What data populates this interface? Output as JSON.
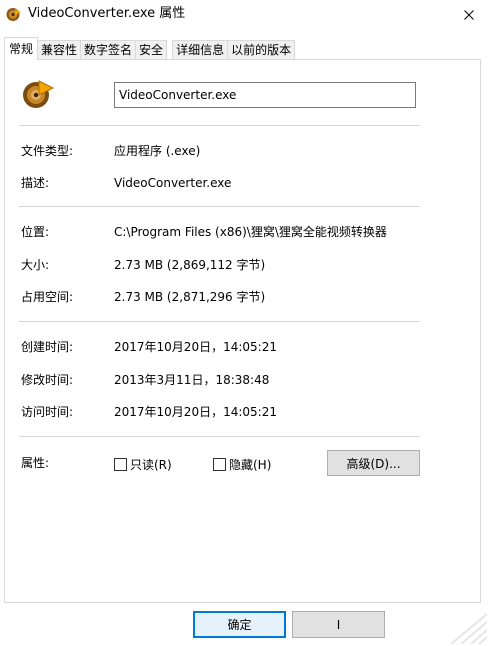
{
  "window": {
    "title": "VideoConverter.exe 属性"
  },
  "tabs": [
    {
      "label": "常规",
      "active": true
    },
    {
      "label": "兼容性",
      "active": false
    },
    {
      "label": "数字签名",
      "active": false
    },
    {
      "label": "安全",
      "active": false
    },
    {
      "label": "详细信息",
      "active": false
    },
    {
      "label": "以前的版本",
      "active": false
    }
  ],
  "general": {
    "filename": "VideoConverter.exe",
    "file_type_label": "文件类型:",
    "file_type_value": "应用程序 (.exe)",
    "description_label": "描述:",
    "description_value": "VideoConverter.exe",
    "location_label": "位置:",
    "location_value": "C:\\Program Files (x86)\\狸窝\\狸窝全能视频转换器",
    "size_label": "大小:",
    "size_value": "2.73 MB (2,869,112 字节)",
    "size_on_disk_label": "占用空间:",
    "size_on_disk_value": "2.73 MB (2,871,296 字节)",
    "created_label": "创建时间:",
    "created_value": "2017年10月20日，14:05:21",
    "modified_label": "修改时间:",
    "modified_value": "2013年3月11日，18:38:48",
    "accessed_label": "访问时间:",
    "accessed_value": "2017年10月20日，14:05:21",
    "attributes_label": "属性:",
    "readonly_label": "只读(R)",
    "readonly_checked": false,
    "hidden_label": "隐藏(H)",
    "hidden_checked": false,
    "advanced_label": "高级(D)..."
  },
  "buttons": {
    "ok_label": "确定",
    "cancel_label": "I"
  },
  "icons": {
    "app": "video-converter-app-icon",
    "file": "video-converter-file-icon",
    "close": "close-icon"
  },
  "colors": {
    "accent": "#0078d7",
    "tab_border": "#d9d9d9",
    "button_face": "#e1e1e1"
  }
}
